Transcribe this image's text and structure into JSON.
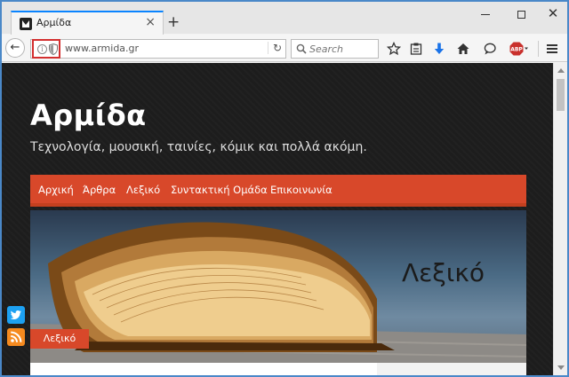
{
  "browser": {
    "tab_title": "Αρμίδα",
    "tab_close": "×",
    "new_tab": "+",
    "window_close": "✕",
    "url": "www.armida.gr",
    "reload": "↻",
    "back": "←",
    "search_placeholder": "Search",
    "info_glyph": "i",
    "abp_label": "ABP"
  },
  "site": {
    "title": "Αρμίδα",
    "tagline": "Τεχνολογία, μουσική, ταινίες, κόμικ και πολλά ακόμη.",
    "menu": [
      "Αρχική",
      "Άρθρα",
      "Λεξικό",
      "Συντακτική Ομάδα",
      "Επικοινωνία"
    ],
    "hero_label": "Λεξικό",
    "hero_tag": "Λεξικό"
  },
  "colors": {
    "accent": "#d8482a",
    "tab_highlight": "#0a84ff",
    "page_bg": "#1d1d1d",
    "twitter": "#1da1f2",
    "rss": "#f58a1f"
  },
  "icons": {
    "toolbar": [
      "bookmark-star-icon",
      "reading-list-icon",
      "download-icon",
      "home-icon",
      "chat-icon",
      "adblock-icon",
      "hamburger-menu-icon"
    ],
    "social": [
      "twitter-icon",
      "rss-icon"
    ]
  }
}
